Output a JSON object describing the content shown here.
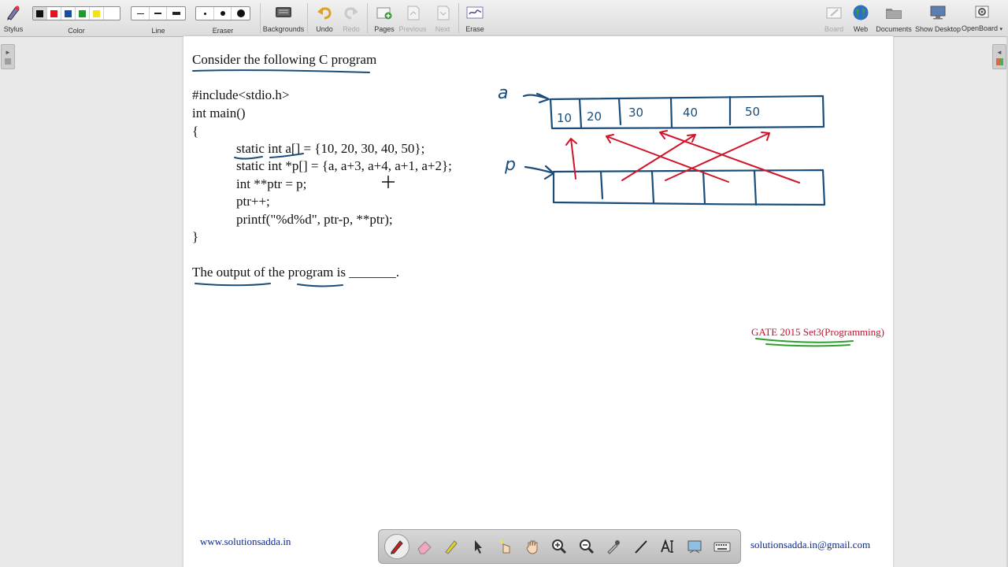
{
  "toolbar": {
    "stylus_label": "Stylus",
    "color_label": "Color",
    "line_label": "Line",
    "eraser_label": "Eraser",
    "backgrounds_label": "Backgrounds",
    "undo_label": "Undo",
    "redo_label": "Redo",
    "pages_label": "Pages",
    "previous_label": "Previous",
    "next_label": "Next",
    "erase_label": "Erase",
    "board_label": "Board",
    "web_label": "Web",
    "documents_label": "Documents",
    "show_desktop_label": "Show Desktop",
    "openboard_label": "OpenBoard",
    "colors": [
      "#111111",
      "#e0141a",
      "#1a4fa0",
      "#1f9b2e",
      "#f2e21c"
    ],
    "selected_color": "#111111"
  },
  "page": {
    "heading": "Consider the following C program",
    "code": [
      "#include<stdio.h>",
      "int main()",
      "{",
      "static int a[] = {10, 20, 30, 40, 50};",
      "static int *p[] = {a, a+3, a+4, a+1, a+2};",
      "int **ptr = p;",
      "ptr++;",
      "printf(\"%d%d\", ptr-p, **ptr);",
      "}"
    ],
    "question": "The output of the program is _______.",
    "source_tag": "GATE 2015 Set3(Programming)",
    "footer_left": "www.solutionsadda.in",
    "footer_right": "solutionsadda.in@gmail.com"
  },
  "annotations": {
    "label_a": "a",
    "label_p": "p",
    "array_a_values": [
      "10",
      "20",
      "30",
      "40",
      "50"
    ],
    "ink_blue": "#1b4d7a",
    "ink_red": "#d0152b",
    "ink_green": "#2e9e2e"
  },
  "palette": {
    "tools": [
      "pen-icon",
      "eraser-icon",
      "highlighter-icon",
      "pointer-icon",
      "laser-pointer-icon",
      "hand-icon",
      "zoom-in-icon",
      "zoom-out-icon",
      "color-picker-icon",
      "line-icon",
      "text-icon",
      "capture-icon",
      "keyboard-icon"
    ],
    "selected": "pen-icon"
  }
}
